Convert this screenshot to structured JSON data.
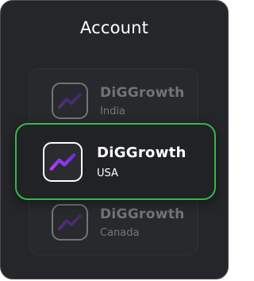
{
  "header": {
    "title": "Account"
  },
  "accounts": [
    {
      "name": "DiGGrowth",
      "region": "India",
      "icon": "trend-up-icon",
      "state": "dimmed"
    },
    {
      "name": "DiGGrowth",
      "region": "USA",
      "icon": "trend-up-icon",
      "state": "selected"
    },
    {
      "name": "DiGGrowth",
      "region": "Canada",
      "icon": "trend-up-icon",
      "state": "dimmed"
    }
  ],
  "colors": {
    "background": "#242629",
    "selected_border": "#3bb54a",
    "icon_gradient_start": "#b23cff",
    "icon_gradient_end": "#6a2ce0"
  }
}
